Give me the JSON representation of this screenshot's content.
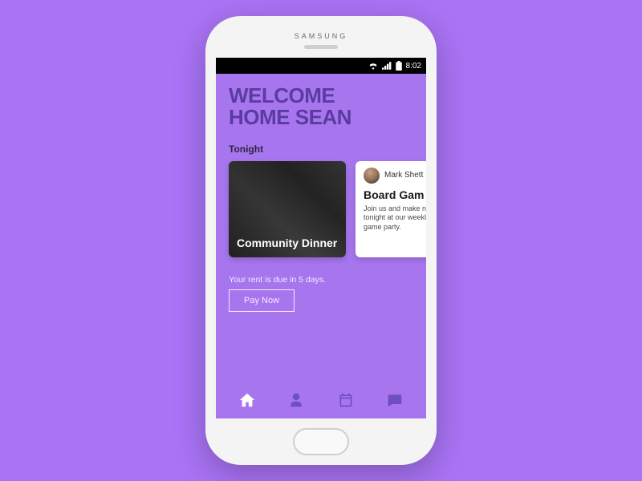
{
  "device": {
    "brand": "SAMSUNG"
  },
  "statusbar": {
    "time": "8:02"
  },
  "welcome": {
    "line1": "WELCOME",
    "line2": "HOME SEAN"
  },
  "section": {
    "tonight_label": "Tonight"
  },
  "cards": [
    {
      "title": "Community Dinner"
    },
    {
      "host_name": "Mark Shett",
      "title": "Board Gam",
      "description": "Join us and make new friends tonight at our weekly board game party."
    }
  ],
  "rent": {
    "message": "Your rent is due in 5 days.",
    "pay_label": "Pay Now"
  },
  "nav": {
    "items": [
      "home",
      "profile",
      "calendar",
      "chat"
    ],
    "active": "home"
  },
  "colors": {
    "background": "#a973f5",
    "screen": "#a776ef",
    "headline": "#5a3ca0",
    "active_icon": "#ffffff",
    "inactive_icon": "#6f4fbf"
  }
}
